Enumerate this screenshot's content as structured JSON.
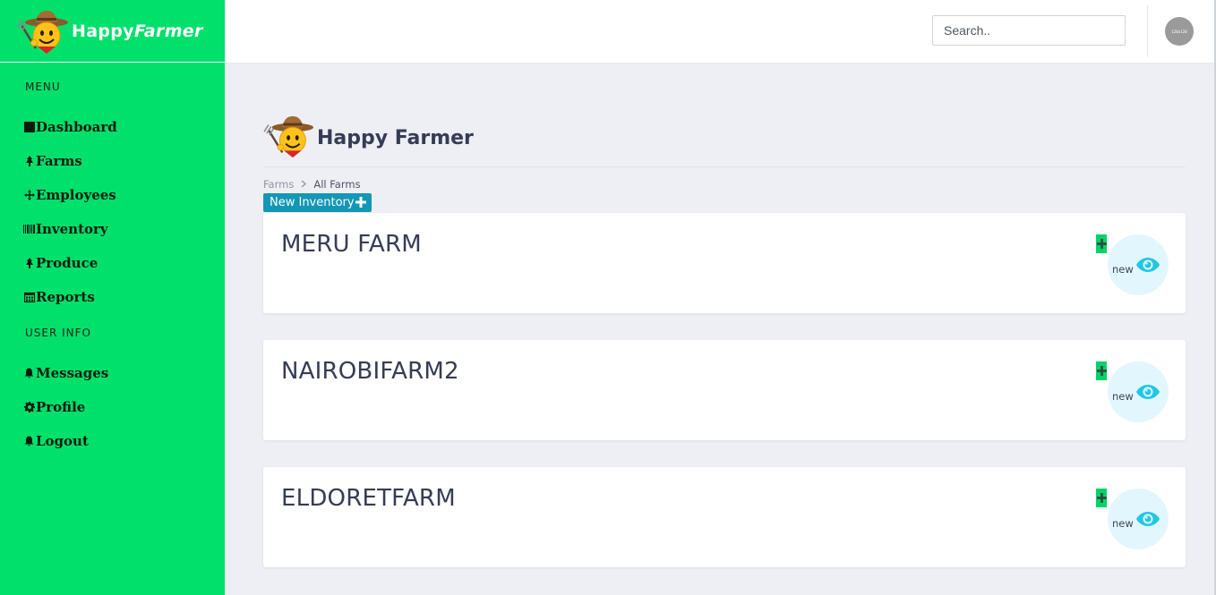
{
  "brand": {
    "name_prefix": "Happy",
    "name_suffix": "Farmer"
  },
  "sidebar": {
    "menu_heading": "MENU",
    "menu_items": [
      {
        "label": "Dashboard",
        "icon": "square-icon"
      },
      {
        "label": "Farms",
        "icon": "tree-icon"
      },
      {
        "label": "Employees",
        "icon": "move-arrows-icon"
      },
      {
        "label": "Inventory",
        "icon": "barcode-icon"
      },
      {
        "label": "Produce",
        "icon": "tree-icon"
      },
      {
        "label": "Reports",
        "icon": "calendar-icon"
      }
    ],
    "user_heading": "USER INFO",
    "user_items": [
      {
        "label": "Messages",
        "icon": "bell-icon"
      },
      {
        "label": "Profile",
        "icon": "gear-icon"
      },
      {
        "label": "Logout",
        "icon": "bell-icon"
      }
    ]
  },
  "topbar": {
    "search_placeholder": "Search..",
    "avatar_text": "128x128"
  },
  "page": {
    "title": "Happy Farmer",
    "breadcrumb": {
      "parent": "Farms",
      "current": "All Farms"
    },
    "new_button_label": "New Inventory"
  },
  "farms": [
    {
      "name": "MERU FARM",
      "view_label": "new"
    },
    {
      "name": "NAIROBIFARM2",
      "view_label": "new"
    },
    {
      "name": "ELDORETFARM",
      "view_label": "new"
    }
  ],
  "colors": {
    "sidebar_bg": "#00e06a",
    "accent_button": "#1397b6",
    "eye_icon": "#22c6e8",
    "page_bg": "#eeeff4"
  }
}
